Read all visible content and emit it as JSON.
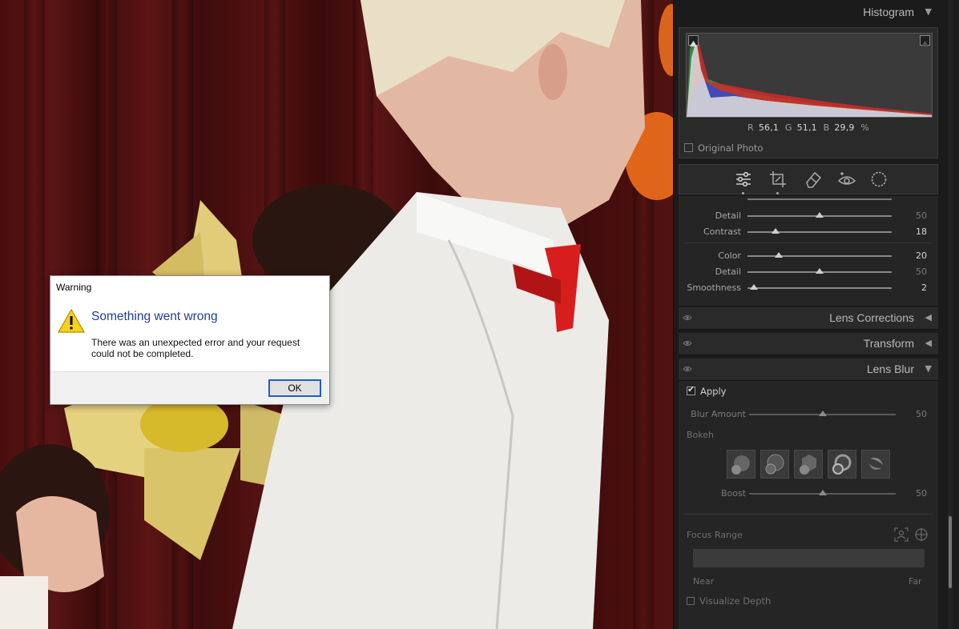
{
  "dialog": {
    "title": "Warning",
    "heading": "Something went wrong",
    "message": "There was an unexpected error and your request could not be completed.",
    "ok_label": "OK",
    "icon": "warning-icon"
  },
  "histogram": {
    "title": "Histogram",
    "r_label": "R",
    "r_value": "56,1",
    "g_label": "G",
    "g_value": "51,1",
    "b_label": "B",
    "b_value": "29,9",
    "unit": "%",
    "original_photo_label": "Original Photo"
  },
  "tools": [
    "edit-sliders-icon",
    "crop-icon",
    "healing-eraser-icon",
    "red-eye-icon",
    "masking-icon"
  ],
  "detail_sliders": [
    {
      "label": "Detail",
      "value": "50",
      "pos": 0.5
    },
    {
      "label": "Contrast",
      "value": "18",
      "pos": 0.18
    },
    {
      "label": "Color",
      "value": "20",
      "pos": 0.22
    },
    {
      "label": "Detail",
      "value": "50",
      "pos": 0.5
    },
    {
      "label": "Smoothness",
      "value": "2",
      "pos": 0.04
    }
  ],
  "sections": {
    "lens_corrections": "Lens Corrections",
    "transform": "Transform",
    "lens_blur": "Lens Blur"
  },
  "lens_blur": {
    "apply_label": "Apply",
    "apply_checked": true,
    "blur_amount_label": "Blur Amount",
    "blur_amount_value": "50",
    "bokeh_label": "Bokeh",
    "boost_label": "Boost",
    "boost_value": "50",
    "focus_range_label": "Focus Range",
    "near_label": "Near",
    "far_label": "Far",
    "visualize_depth_label": "Visualize Depth"
  },
  "colors": {
    "accent_blue": "#1f5fbf",
    "heading_blue": "#1f3f8f",
    "panel_bg": "#1b1b1b"
  }
}
